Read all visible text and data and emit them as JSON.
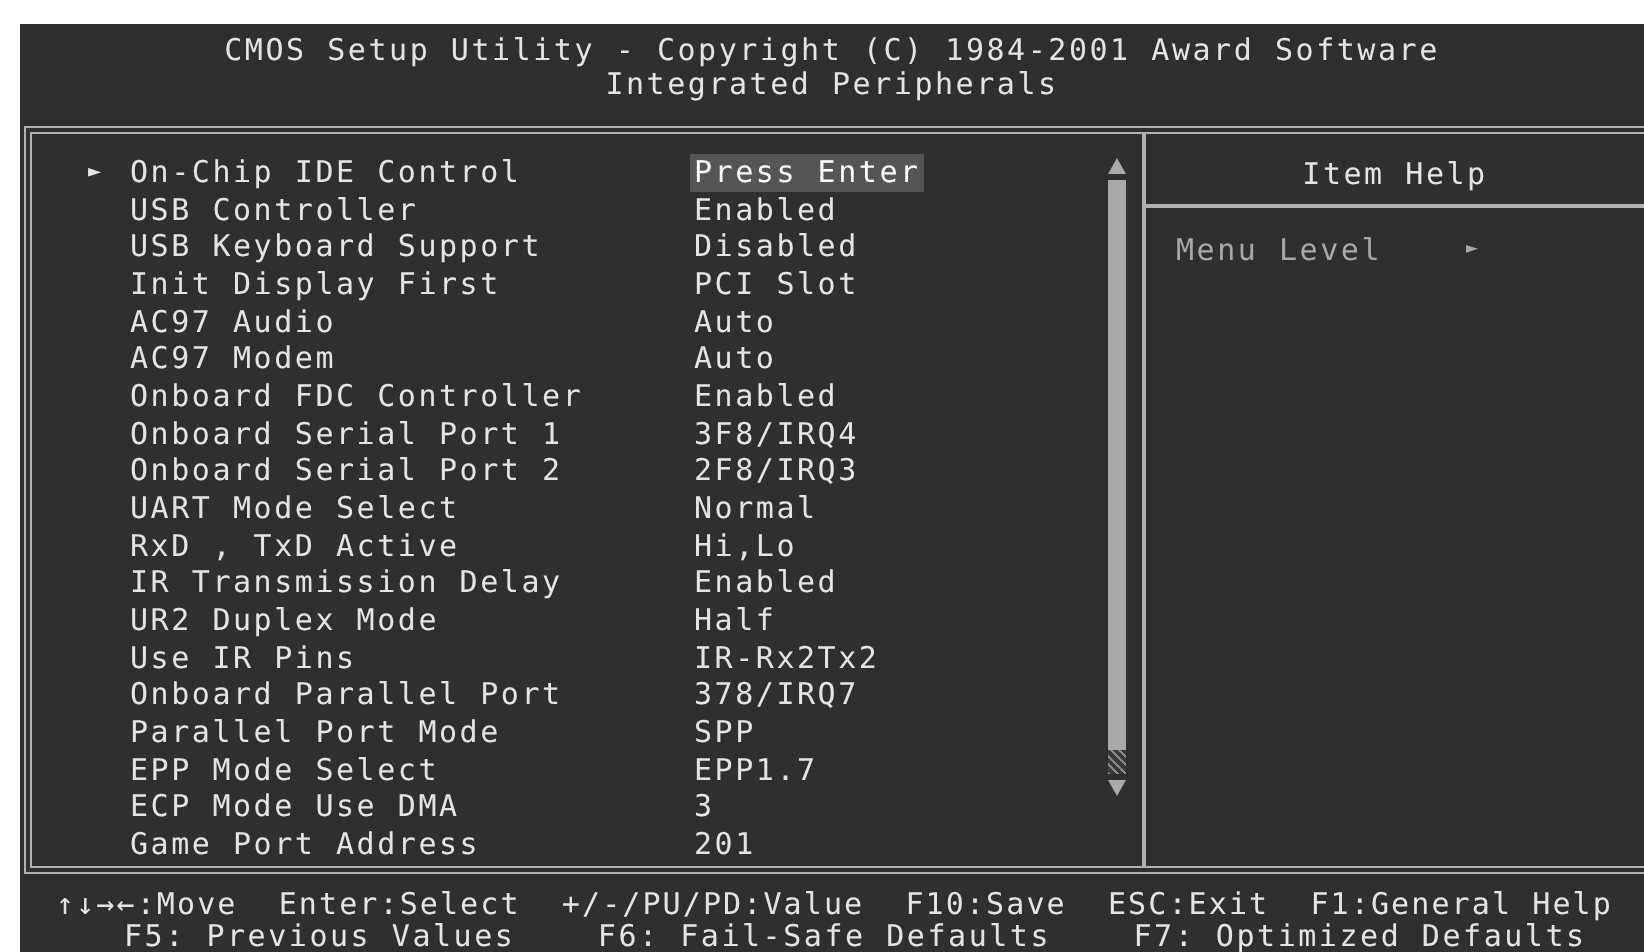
{
  "header": {
    "title": "CMOS Setup Utility - Copyright (C) 1984-2001 Award Software",
    "subtitle": "Integrated Peripherals"
  },
  "settings": [
    {
      "label": "On-Chip IDE Control",
      "value": "Press Enter",
      "marker": "►",
      "selected": true
    },
    {
      "label": "USB Controller",
      "value": "Enabled",
      "selected": false
    },
    {
      "label": "USB Keyboard Support",
      "value": "Disabled",
      "selected": false
    },
    {
      "label": "Init Display First",
      "value": "PCI Slot",
      "selected": false
    },
    {
      "label": "AC97 Audio",
      "value": "Auto",
      "selected": false
    },
    {
      "label": "AC97 Modem",
      "value": "Auto",
      "selected": false
    },
    {
      "label": "Onboard FDC Controller",
      "value": "Enabled",
      "selected": false
    },
    {
      "label": "Onboard Serial Port 1",
      "value": "3F8/IRQ4",
      "selected": false
    },
    {
      "label": "Onboard Serial Port 2",
      "value": "2F8/IRQ3",
      "selected": false
    },
    {
      "label": "UART Mode Select",
      "value": "Normal",
      "selected": false
    },
    {
      "label": "RxD , TxD Active",
      "value": "Hi,Lo",
      "selected": false
    },
    {
      "label": "IR Transmission Delay",
      "value": "Enabled",
      "selected": false
    },
    {
      "label": "UR2 Duplex Mode",
      "value": "Half",
      "selected": false
    },
    {
      "label": "Use IR Pins",
      "value": "IR-Rx2Tx2",
      "selected": false
    },
    {
      "label": "Onboard Parallel Port",
      "value": "378/IRQ7",
      "selected": false
    },
    {
      "label": "Parallel Port Mode",
      "value": "SPP",
      "selected": false
    },
    {
      "label": "EPP Mode Select",
      "value": "EPP1.7",
      "selected": false
    },
    {
      "label": "ECP Mode Use DMA",
      "value": "3",
      "selected": false
    },
    {
      "label": "Game Port Address",
      "value": "201",
      "selected": false
    }
  ],
  "help": {
    "title": "Item Help",
    "menu_level": "Menu Level",
    "menu_level_marker": "►"
  },
  "key_legend": [
    {
      "items": [
        "↑↓→←:Move",
        "Enter:Select",
        "+/-/PU/PD:Value",
        "F10:Save",
        "ESC:Exit",
        "F1:General Help"
      ]
    },
    {
      "items": [
        "F5: Previous Values",
        "F6: Fail-Safe Defaults",
        "F7: Optimized Defaults"
      ]
    }
  ]
}
